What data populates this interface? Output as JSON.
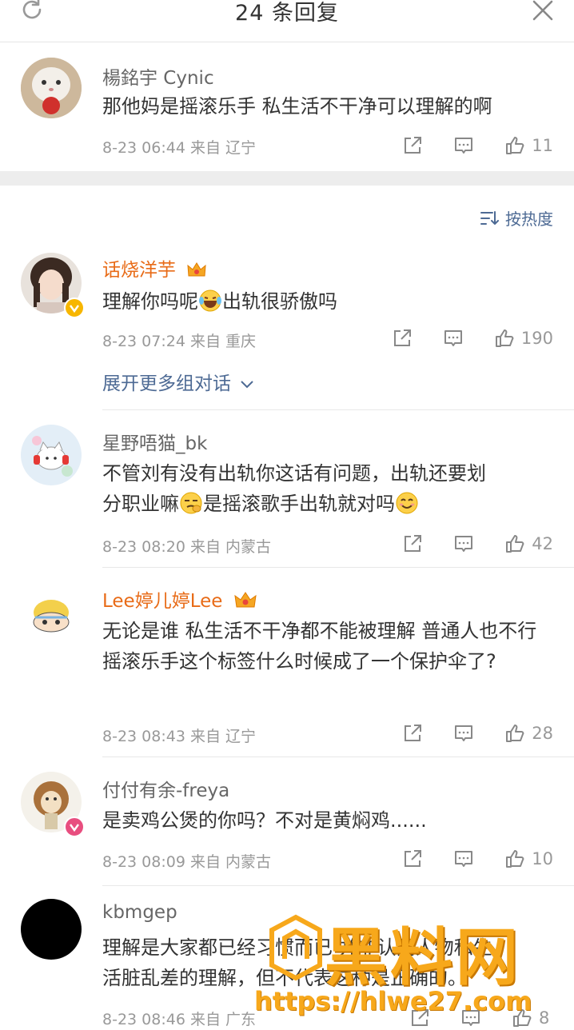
{
  "header": {
    "title": "24 条回复"
  },
  "root_comment": {
    "name": "楊銘宇 Cynic",
    "text": "那他妈是摇滚乐手 私生活不干净可以理解的啊",
    "meta": "8-23 06:44 来自 辽宁",
    "likes": "11"
  },
  "sort_label": "按热度",
  "expand_label": "展开更多组对话",
  "replies": [
    {
      "name": "话烧洋芋",
      "text_before": "理解你吗呢",
      "text_after": "出轨很骄傲吗",
      "meta": "8-23 07:24 来自 重庆",
      "likes": "190"
    },
    {
      "name": "星野唔猫_bk",
      "text_line1": "不管刘有没有出轨你这话有问题，出轨还要划",
      "text_before": "分职业嘛",
      "text_mid": "是摇滚歌手出轨就对吗",
      "meta": "8-23 08:20 来自 内蒙古",
      "likes": "42"
    },
    {
      "name": "Lee婷儿婷Lee",
      "text": "无论是谁 私生活不干净都不能被理解 普通人也不行 摇滚乐手这个标签什么时候成了一个保护伞了?",
      "meta": "8-23 08:43 来自 辽宁",
      "likes": "28"
    },
    {
      "name": "付付有余-freya",
      "text": "是卖鸡公煲的你吗？不对是黄焖鸡......",
      "meta": "8-23 08:09 来自 内蒙古",
      "likes": "10"
    },
    {
      "name": "kbmgep",
      "text_line1": "理解是大家都已经习惯而已 并非认同人物私生",
      "text_line2": "活脏乱差的理解，但不代表这种是正确的。",
      "meta": "8-23 08:46 来自 广东",
      "likes": "8"
    }
  ],
  "watermark": {
    "brand": "黑料网",
    "url": "https://hlwe27.com"
  },
  "colors": {
    "orange_name": "#e86b17",
    "link_blue": "#4d6a94",
    "meta_gray": "#999999"
  }
}
